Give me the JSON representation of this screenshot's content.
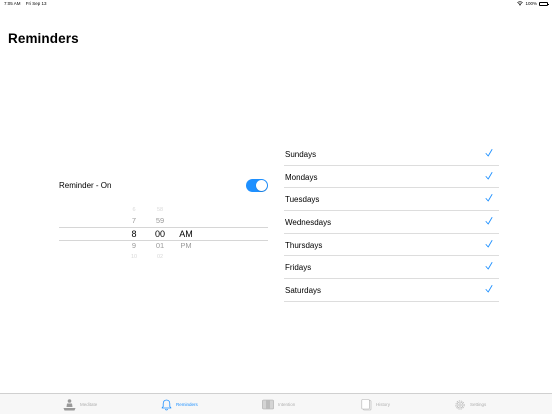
{
  "status_bar": {
    "time": "7:05 AM",
    "date": "Fri Sep 13",
    "battery": "100%"
  },
  "page": {
    "title": "Reminders"
  },
  "reminder": {
    "label": "Reminder - On",
    "enabled": true
  },
  "time_picker": {
    "hours": [
      "6",
      "7",
      "8",
      "9",
      "10"
    ],
    "minutes": [
      "58",
      "59",
      "00",
      "01",
      "02"
    ],
    "periods": [
      "",
      "",
      "AM",
      "PM",
      ""
    ],
    "selected": {
      "hour": "8",
      "minute": "00",
      "period": "AM"
    }
  },
  "days": [
    {
      "label": "Sundays",
      "checked": true
    },
    {
      "label": "Mondays",
      "checked": true
    },
    {
      "label": "Tuesdays",
      "checked": true
    },
    {
      "label": "Wednesdays",
      "checked": true
    },
    {
      "label": "Thursdays",
      "checked": true
    },
    {
      "label": "Fridays",
      "checked": true
    },
    {
      "label": "Saturdays",
      "checked": true
    }
  ],
  "tabs": [
    {
      "label": "Meditate",
      "icon": "meditate-icon",
      "active": false
    },
    {
      "label": "Reminders",
      "icon": "bell-icon",
      "active": true
    },
    {
      "label": "Intention",
      "icon": "intention-icon",
      "active": false
    },
    {
      "label": "History",
      "icon": "history-icon",
      "active": false
    },
    {
      "label": "Settings",
      "icon": "gear-icon",
      "active": false
    }
  ],
  "colors": {
    "accent": "#1e90ff",
    "inactive": "#b0b0b0"
  }
}
